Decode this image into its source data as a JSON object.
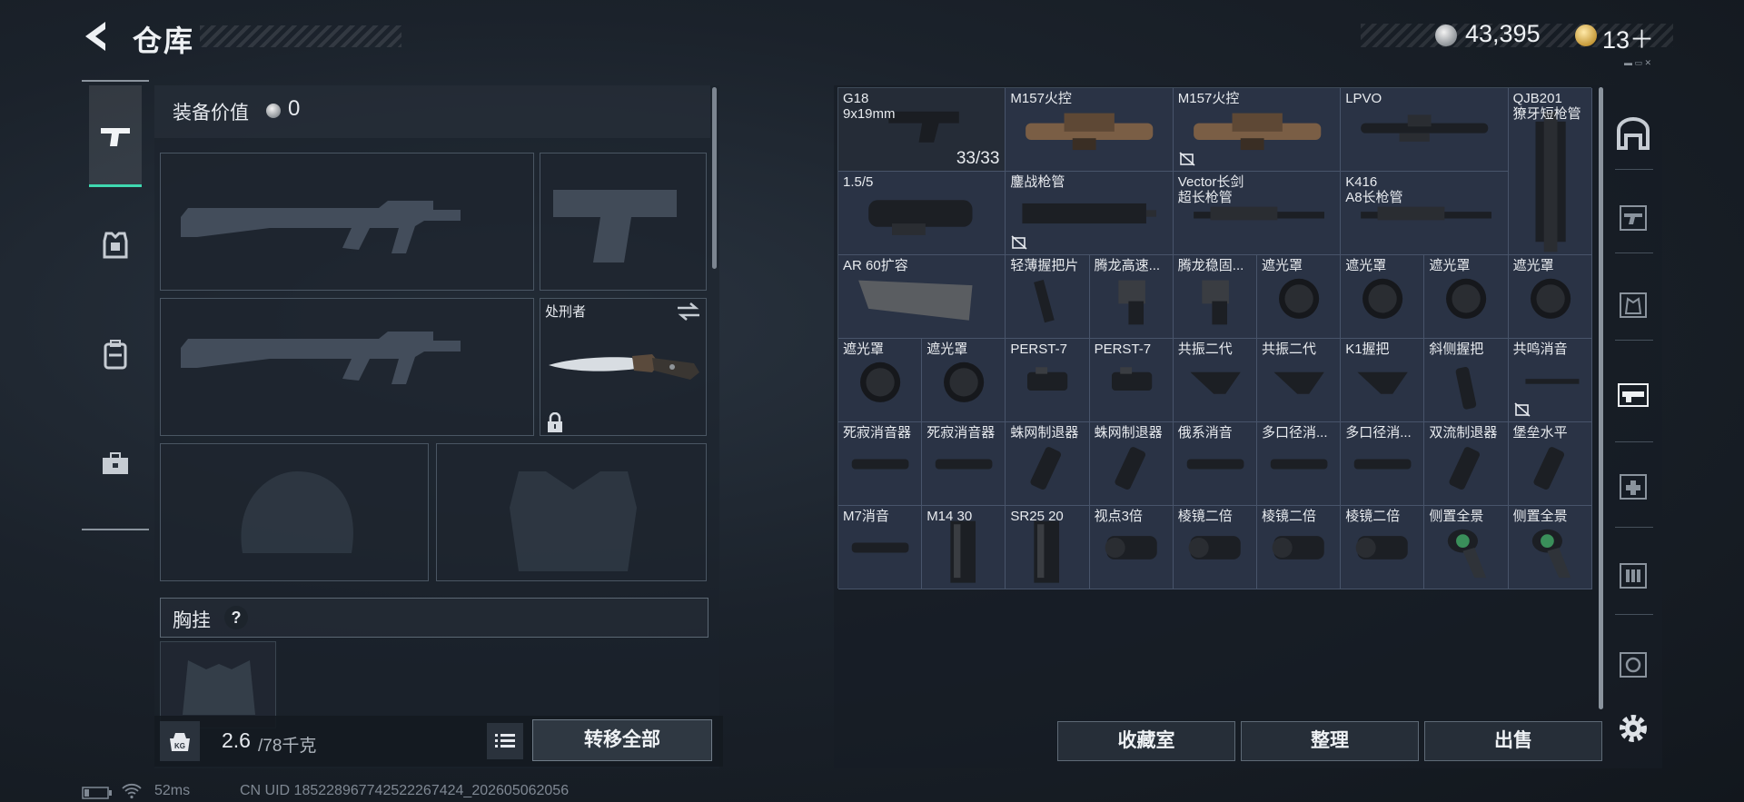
{
  "header": {
    "title": "仓库",
    "currency_silver": "43,395",
    "currency_gold": "13＋",
    "mini_text": "▬ ▭ ✕"
  },
  "loadout": {
    "equip_value_label": "装备价值",
    "equip_value": "0",
    "knife_name": "处刑者",
    "chest_label": "胸挂",
    "chest_help": "?",
    "weight_value": "2.6",
    "weight_max": "/78千克",
    "transfer_all": "转移全部"
  },
  "left_nav": [
    "pistol-icon",
    "armor-icon",
    "backpack-icon",
    "toolbox-icon"
  ],
  "storage": {
    "items": [
      {
        "label": "G18\n9x19mm",
        "count": "33/33",
        "icon": "pistol",
        "dark": true
      },
      {
        "label": "M157火控",
        "icon": "scope-tan"
      },
      {
        "label": "M157火控",
        "icon": "scope-tan",
        "flag": true
      },
      {
        "label": "LPVO",
        "icon": "scope-long"
      },
      {
        "label": "QJB201\n獠牙短枪管",
        "icon": "barrel-vertical"
      },
      {
        "label": "1.5/5",
        "icon": "scope-thick"
      },
      {
        "label": "鏖战枪管",
        "icon": "handguard",
        "flag": true
      },
      {
        "label": "Vector长剑\n超长枪管",
        "icon": "long-barrel"
      },
      {
        "label": "K416\nA8长枪管",
        "icon": "long-barrel"
      },
      {
        "label": "AR 60扩容",
        "icon": "magazine-wide"
      },
      {
        "label": "轻薄握把片",
        "icon": "grip-plate"
      },
      {
        "label": "腾龙高速...",
        "icon": "stock-part"
      },
      {
        "label": "腾龙稳固...",
        "icon": "stock-part"
      },
      {
        "label": "遮光罩",
        "icon": "hood"
      },
      {
        "label": "遮光罩",
        "icon": "hood"
      },
      {
        "label": "遮光罩",
        "icon": "hood"
      },
      {
        "label": "遮光罩",
        "icon": "hood"
      },
      {
        "label": "遮光罩",
        "icon": "hood"
      },
      {
        "label": "遮光罩",
        "icon": "hood"
      },
      {
        "label": "PERST-7",
        "icon": "laser"
      },
      {
        "label": "PERST-7",
        "icon": "laser"
      },
      {
        "label": "共振二代",
        "icon": "angled-grip"
      },
      {
        "label": "共振二代",
        "icon": "angled-grip"
      },
      {
        "label": "K1握把",
        "icon": "angled-grip"
      },
      {
        "label": "斜侧握把",
        "icon": "vertical-grip"
      },
      {
        "label": "共鸣消音",
        "icon": "thin-suppressor",
        "flag": true
      },
      {
        "label": "死寂消音器",
        "icon": "suppressor"
      },
      {
        "label": "死寂消音器",
        "icon": "suppressor"
      },
      {
        "label": "蛛网制退器",
        "icon": "brake"
      },
      {
        "label": "蛛网制退器",
        "icon": "brake"
      },
      {
        "label": "俄系消音",
        "icon": "suppressor"
      },
      {
        "label": "多口径消...",
        "icon": "suppressor"
      },
      {
        "label": "多口径消...",
        "icon": "suppressor"
      },
      {
        "label": "双流制退器",
        "icon": "brake"
      },
      {
        "label": "堡垒水平",
        "icon": "brake"
      },
      {
        "label": "M7消音",
        "icon": "suppressor"
      },
      {
        "label": "M14 30",
        "icon": "magazine-tall"
      },
      {
        "label": "SR25 20",
        "icon": "magazine-tall"
      },
      {
        "label": "视点3倍",
        "icon": "scope-small"
      },
      {
        "label": "棱镜二倍",
        "icon": "scope-small"
      },
      {
        "label": "棱镜二倍",
        "icon": "scope-small"
      },
      {
        "label": "棱镜二倍",
        "icon": "scope-small"
      },
      {
        "label": "侧置全景",
        "icon": "side-sight"
      },
      {
        "label": "侧置全景",
        "icon": "side-sight"
      }
    ],
    "buttons": {
      "collection": "收藏室",
      "sort": "整理",
      "sell": "出售"
    }
  },
  "right_nav": [
    "all-items-icon",
    "weapons-icon",
    "equipment-icon",
    "attachments-icon",
    "medical-icon",
    "ammo-icon",
    "misc-icon"
  ],
  "status_bar": {
    "ping": "52ms",
    "uid": "CN UID 185228967742522267424_202605062056"
  }
}
